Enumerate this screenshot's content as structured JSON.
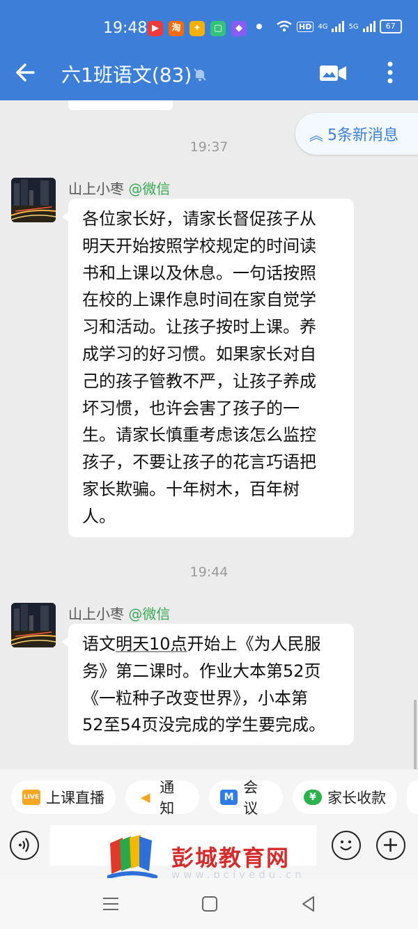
{
  "status_bar": {
    "time": "19:48",
    "apps": [
      {
        "icon": "video-app-icon",
        "glyph": "▶",
        "color": "#f03a3a"
      },
      {
        "icon": "taobao-icon",
        "glyph": "淘",
        "color": "#ff6a00"
      },
      {
        "icon": "shopping-app-icon",
        "glyph": "✦",
        "color": "#f5b000"
      },
      {
        "icon": "chat-app-icon",
        "glyph": "▢",
        "color": "#33c27a"
      },
      {
        "icon": "gallery-app-icon",
        "glyph": "◆",
        "color": "#8a5cf6"
      }
    ],
    "hd_label": "HD",
    "net1": "4G",
    "net2": "5G",
    "battery": "67"
  },
  "header": {
    "title": "六1班语文(83)",
    "back_icon": "back-arrow-icon",
    "mute_icon": "bell-off-icon",
    "video_icon": "video-call-icon",
    "more_icon": "more-vertical-icon"
  },
  "chat": {
    "new_messages": {
      "arrow": "︽",
      "label": "5条新消息"
    },
    "messages": [
      {
        "time": "19:37",
        "sender": "山上小枣",
        "source": "@微信",
        "lines": [
          "各位家长好，请家长督促孩子从",
          "明天开始按照学校规定的时间读",
          "书和上课以及休息。一句话按照",
          "在校的上课作息时间在家自觉学",
          "习和活动。让孩子按时上课。养",
          "成学习的好习惯。如果家长对自",
          "己的孩子管教不严，让孩子养成",
          "坏习惯，也许会害了孩子的一",
          "生。请家长慎重考虑该怎么监控",
          "孩子，不要让孩子的花言巧语把",
          "家长欺骗。十年树木，百年树",
          "人。"
        ]
      },
      {
        "time": "19:44",
        "sender": "山上小枣",
        "source": "@微信",
        "line1_pre": "语文",
        "line1_link": "明天10点",
        "line1_post": "开始上《为人民服",
        "lines": [
          "务》第二课时。作业大本第52页",
          "《一粒种子改变世界》，小本第",
          "52至54页没完成的学生要完成。"
        ]
      }
    ]
  },
  "quick_actions": [
    {
      "label": "上课直播",
      "icon": "live-icon",
      "badge": "LIVE",
      "color": "#f5a623"
    },
    {
      "label": "通知",
      "icon": "megaphone-icon",
      "badge": "◀",
      "color": "#f5a623"
    },
    {
      "label": "会议",
      "icon": "meeting-icon",
      "badge": "M",
      "color": "#2f7be8"
    },
    {
      "label": "家长收款",
      "icon": "payment-icon",
      "badge": "¥",
      "color": "#2bb24c"
    }
  ],
  "input_bar": {
    "voice_icon": "voice-icon",
    "emoji_icon": "emoji-icon",
    "plus_icon": "plus-icon"
  },
  "watermark": {
    "text": "彭城教育网",
    "url": "www.pcjyedu.cn"
  },
  "nav_bar": {
    "menu_icon": "menu-icon",
    "home_icon": "home-square-icon",
    "back_icon": "back-triangle-icon"
  }
}
